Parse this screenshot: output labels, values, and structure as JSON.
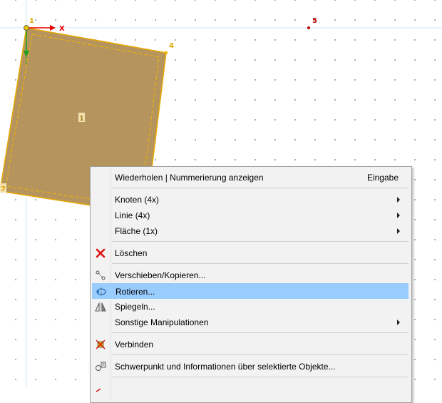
{
  "colors": {
    "surface_fill": "#b5955d",
    "surface_edge": "#f0b400",
    "axis_x": "#e60000",
    "axis_y": "#1aa01a",
    "node_label": "#e6a800",
    "node5_label": "#b40000",
    "menu_bg": "#f2f2f2",
    "highlight": "#99ccff"
  },
  "canvas": {
    "node_labels": {
      "n1": "1",
      "n4": "4",
      "n5": "5",
      "n7": "7"
    },
    "surface_label": "1",
    "axis_x_label": "X"
  },
  "context_menu": {
    "items": [
      {
        "label": "Wiederholen | Nummerierung anzeigen",
        "shortcut": "Eingabe"
      },
      {
        "label": "Knoten (4x)",
        "submenu": true
      },
      {
        "label": "Linie (4x)",
        "submenu": true
      },
      {
        "label": "Fläche (1x)",
        "submenu": true
      },
      {
        "label": "Löschen",
        "icon": "delete-x-icon"
      },
      {
        "label": "Verschieben/Kopieren...",
        "icon": "move-copy-icon"
      },
      {
        "label": "Rotieren...",
        "icon": "rotate-icon",
        "highlighted": true
      },
      {
        "label": "Spiegeln...",
        "icon": "mirror-icon"
      },
      {
        "label": "Sonstige Manipulationen",
        "submenu": true
      },
      {
        "label": "Verbinden",
        "icon": "connect-icon"
      },
      {
        "label": "Schwerpunkt und Informationen über selektierte Objekte...",
        "icon": "centroid-info-icon"
      }
    ]
  }
}
